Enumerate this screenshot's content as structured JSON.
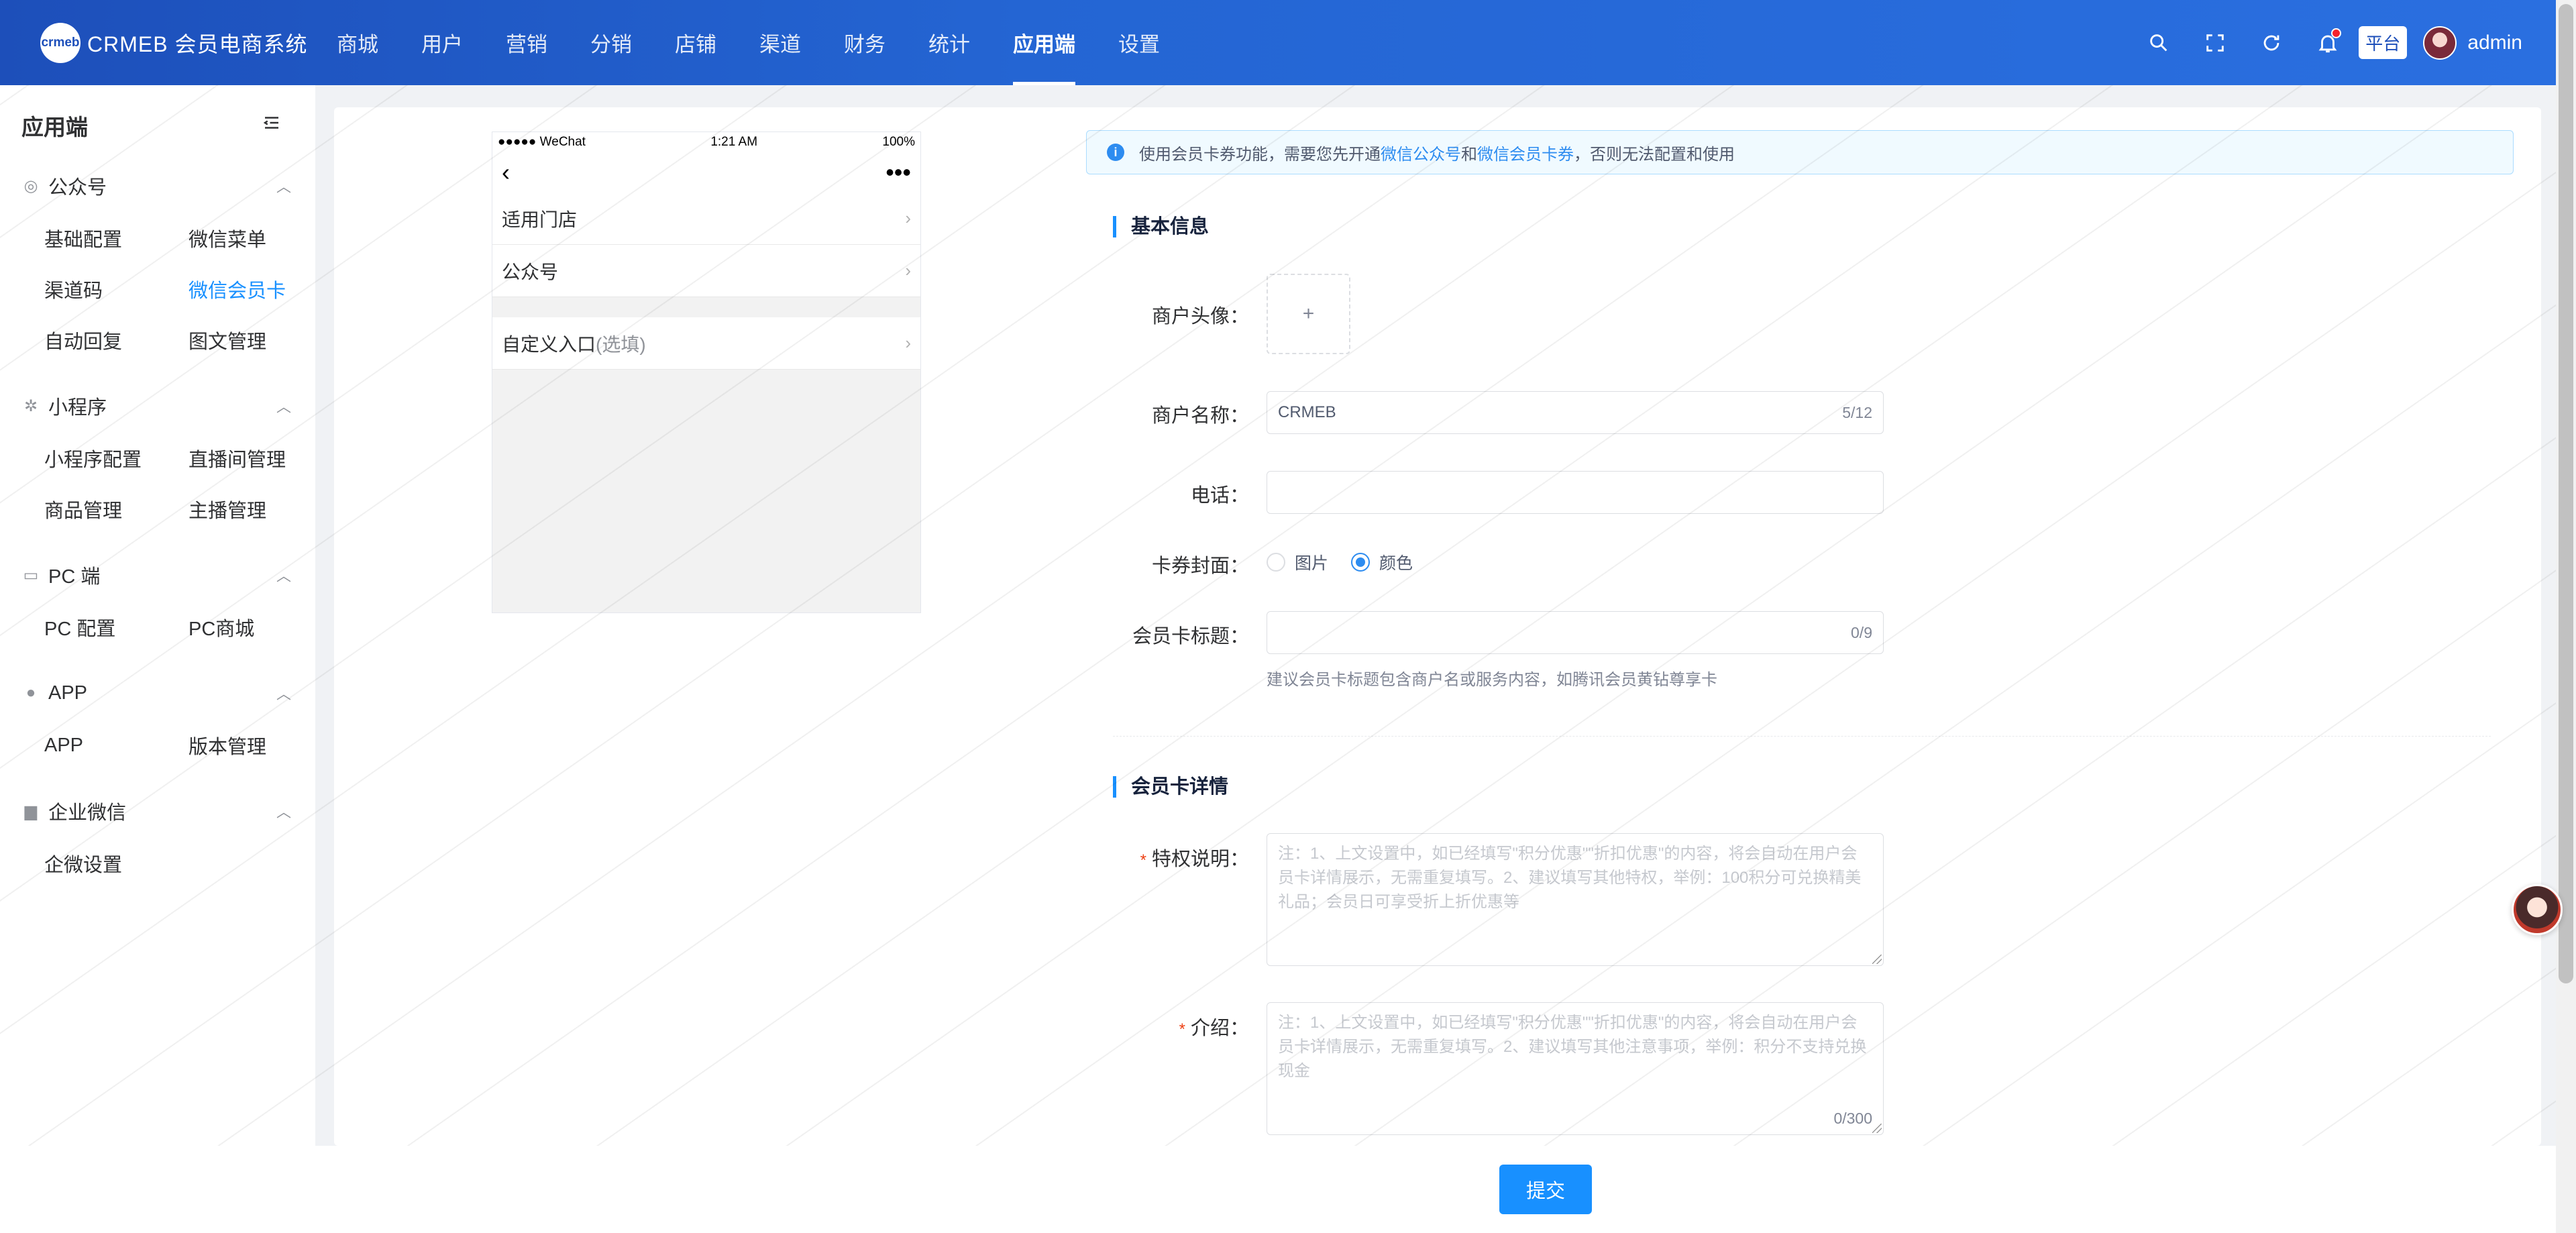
{
  "header": {
    "logo_mark": "crmeb",
    "logo_text": "CRMEB 会员电商系统",
    "nav": [
      "商城",
      "用户",
      "营销",
      "分销",
      "店铺",
      "渠道",
      "财务",
      "统计",
      "应用端",
      "设置"
    ],
    "active_nav": "应用端",
    "platform_badge": "平台",
    "username": "admin"
  },
  "sidebar": {
    "title": "应用端",
    "groups": [
      {
        "label": "公众号",
        "items": [
          "基础配置",
          "微信菜单",
          "渠道码",
          "微信会员卡",
          "自动回复",
          "图文管理"
        ]
      },
      {
        "label": "小程序",
        "items": [
          "小程序配置",
          "直播间管理",
          "商品管理",
          "主播管理"
        ]
      },
      {
        "label": "PC 端",
        "items": [
          "PC 配置",
          "PC商城"
        ]
      },
      {
        "label": "APP",
        "items": [
          "APP",
          "版本管理"
        ]
      },
      {
        "label": "企业微信",
        "items": [
          "企微设置"
        ]
      }
    ],
    "active_item": "微信会员卡"
  },
  "phone": {
    "carrier": "●●●●● WeChat",
    "time": "1:21 AM",
    "battery": "100%",
    "rows": [
      {
        "label": "适用门店"
      },
      {
        "label": "公众号"
      },
      {
        "label": "自定义入口",
        "suffix": "(选填)"
      }
    ]
  },
  "alert": {
    "prefix": "使用会员卡券功能，需要您先开通",
    "link1": "微信公众号",
    "mid": "和",
    "link2": "微信会员卡券",
    "suffix": "，否则无法配置和使用"
  },
  "form": {
    "section_basic": "基本信息",
    "avatar_label": "商户头像：",
    "avatar_plus": "+",
    "name_label": "商户名称：",
    "name_value": "CRMEB",
    "name_count": "5/12",
    "phone_label": "电话：",
    "phone_value": "",
    "cover_label": "卡券封面：",
    "cover_options": [
      "图片",
      "颜色"
    ],
    "cover_selected": "颜色",
    "title_label": "会员卡标题：",
    "title_value": "",
    "title_count": "0/9",
    "title_hint": "建议会员卡标题包含商户名或服务内容，如腾讯会员黄钻尊享卡",
    "section_detail": "会员卡详情",
    "privilege_label": "特权说明：",
    "privilege_placeholder": "注：1、上文设置中，如已经填写\"积分优惠\"\"折扣优惠\"的内容，将会自动在用户会员卡详情展示，无需重复填写。2、建议填写其他特权，举例：100积分可兑换精美礼品；会员日可享受折上折优惠等",
    "intro_label": "介绍：",
    "intro_placeholder": "注：1、上文设置中，如已经填写\"积分优惠\"\"折扣优惠\"的内容，将会自动在用户会员卡详情展示，无需重复填写。2、建议填写其他注意事项，举例：积分不支持兑换现金",
    "intro_count": "0/300",
    "required_mark": "*"
  },
  "footer": {
    "submit_label": "提交"
  }
}
